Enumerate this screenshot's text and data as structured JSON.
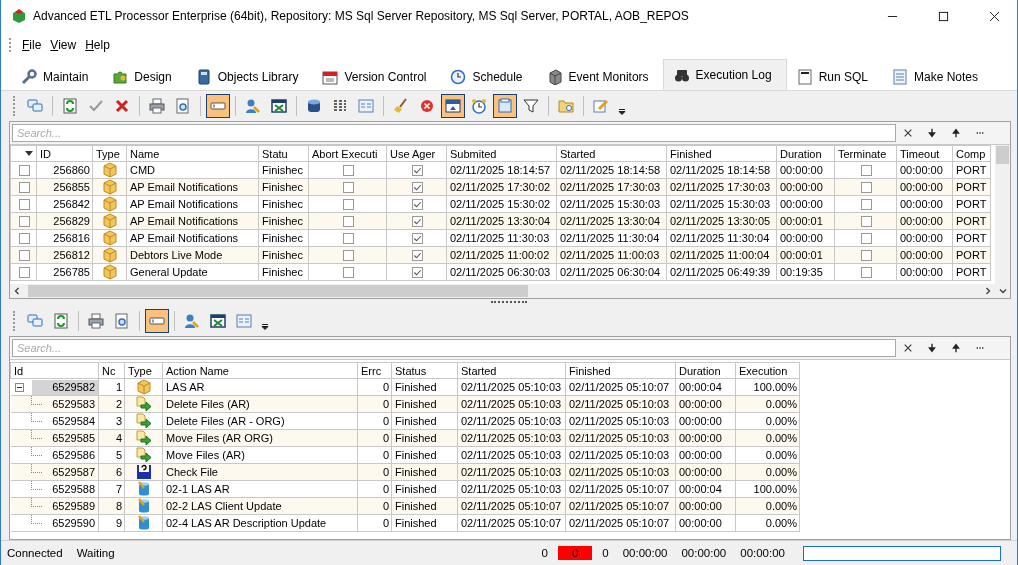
{
  "window": {
    "title": "Advanced ETL Processor Enterprise (64bit), Repository: MS Sql Server Repository, MS Sql Server, PORTAL, AOB_REPOS"
  },
  "menu": [
    "File",
    "View",
    "Help"
  ],
  "tabs": [
    {
      "label": "Maintain",
      "selected": false
    },
    {
      "label": "Design",
      "selected": false
    },
    {
      "label": "Objects Library",
      "selected": false
    },
    {
      "label": "Version Control",
      "selected": false
    },
    {
      "label": "Schedule",
      "selected": false
    },
    {
      "label": "Event Monitors",
      "selected": false
    },
    {
      "label": "Execution Log",
      "selected": true
    },
    {
      "label": "Run SQL",
      "selected": false
    },
    {
      "label": "Make Notes",
      "selected": false
    }
  ],
  "toolbar": [
    {
      "kind": "comment",
      "on": false
    },
    {
      "kind": "separator"
    },
    {
      "kind": "refresh",
      "on": false
    },
    {
      "kind": "check",
      "on": false
    },
    {
      "kind": "delete",
      "on": false
    },
    {
      "kind": "separator"
    },
    {
      "kind": "print",
      "on": false
    },
    {
      "kind": "preview",
      "on": false
    },
    {
      "kind": "separator"
    },
    {
      "kind": "field",
      "on": true
    },
    {
      "kind": "separator"
    },
    {
      "kind": "userdb",
      "on": false
    },
    {
      "kind": "excel",
      "on": false
    },
    {
      "kind": "separator"
    },
    {
      "kind": "database",
      "on": false
    },
    {
      "kind": "columns",
      "on": false
    },
    {
      "kind": "form",
      "on": false
    },
    {
      "kind": "separator"
    },
    {
      "kind": "broom",
      "on": false
    },
    {
      "kind": "stop",
      "on": false
    },
    {
      "kind": "panel",
      "on": true
    },
    {
      "kind": "clock",
      "on": false
    },
    {
      "kind": "panel2",
      "on": true
    },
    {
      "kind": "filter",
      "on": false
    },
    {
      "kind": "separator"
    },
    {
      "kind": "folder",
      "on": false
    },
    {
      "kind": "separator"
    },
    {
      "kind": "edit",
      "on": false
    },
    {
      "kind": "dropdown",
      "on": false
    }
  ],
  "log_search": {
    "placeholder": "Search..."
  },
  "log_table": {
    "columns": [
      "ID",
      "Type",
      "Name",
      "Statu",
      "Abort Executi",
      "Use Ager",
      "Submited",
      "Started",
      "Finished",
      "Duration",
      "Terminate",
      "Timeout",
      "Comp"
    ],
    "rows": [
      {
        "selected": false,
        "id": "256860",
        "kind": "package",
        "name": "CMD",
        "status": "Finishec",
        "abort_execution": false,
        "use_agent": true,
        "submitted": "02/11/2025 18:14:57",
        "started": "02/11/2025 18:14:58",
        "finished": "02/11/2025 18:14:58",
        "duration": "00:00:00",
        "terminate": false,
        "timeout": "00:00:00",
        "company": "PORT"
      },
      {
        "selected": false,
        "id": "256855",
        "kind": "package",
        "name": "AP Email Notifications",
        "status": "Finishec",
        "abort_execution": false,
        "use_agent": true,
        "submitted": "02/11/2025 17:30:02",
        "started": "02/11/2025 17:30:03",
        "finished": "02/11/2025 17:30:03",
        "duration": "00:00:00",
        "terminate": false,
        "timeout": "00:00:00",
        "company": "PORT"
      },
      {
        "selected": false,
        "id": "256842",
        "kind": "package",
        "name": "AP Email Notifications",
        "status": "Finishec",
        "abort_execution": false,
        "use_agent": true,
        "submitted": "02/11/2025 15:30:02",
        "started": "02/11/2025 15:30:03",
        "finished": "02/11/2025 15:30:03",
        "duration": "00:00:00",
        "terminate": false,
        "timeout": "00:00:00",
        "company": "PORT"
      },
      {
        "selected": false,
        "id": "256829",
        "kind": "package",
        "name": "AP Email Notifications",
        "status": "Finishec",
        "abort_execution": false,
        "use_agent": true,
        "submitted": "02/11/2025 13:30:04",
        "started": "02/11/2025 13:30:04",
        "finished": "02/11/2025 13:30:05",
        "duration": "00:00:01",
        "terminate": false,
        "timeout": "00:00:00",
        "company": "PORT"
      },
      {
        "selected": false,
        "id": "256816",
        "kind": "package",
        "name": "AP Email Notifications",
        "status": "Finishec",
        "abort_execution": false,
        "use_agent": true,
        "submitted": "02/11/2025 11:30:03",
        "started": "02/11/2025 11:30:04",
        "finished": "02/11/2025 11:30:04",
        "duration": "00:00:00",
        "terminate": false,
        "timeout": "00:00:00",
        "company": "PORT"
      },
      {
        "selected": false,
        "id": "256812",
        "kind": "package",
        "name": "Debtors Live Mode",
        "status": "Finishec",
        "abort_execution": false,
        "use_agent": true,
        "submitted": "02/11/2025 11:00:02",
        "started": "02/11/2025 11:00:03",
        "finished": "02/11/2025 11:00:04",
        "duration": "00:00:01",
        "terminate": false,
        "timeout": "00:00:00",
        "company": "PORT"
      },
      {
        "selected": false,
        "id": "256785",
        "kind": "package",
        "name": "General Update",
        "status": "Finishec",
        "abort_execution": false,
        "use_agent": true,
        "submitted": "02/11/2025 06:30:03",
        "started": "02/11/2025 06:30:04",
        "finished": "02/11/2025 06:49:39",
        "duration": "00:19:35",
        "terminate": false,
        "timeout": "00:00:00",
        "company": "PORT"
      }
    ]
  },
  "detail_toolbar": [
    {
      "kind": "comment",
      "on": false
    },
    {
      "kind": "refresh",
      "on": false
    },
    {
      "kind": "separator"
    },
    {
      "kind": "print",
      "on": false
    },
    {
      "kind": "preview",
      "on": false
    },
    {
      "kind": "separator"
    },
    {
      "kind": "field",
      "on": true
    },
    {
      "kind": "separator"
    },
    {
      "kind": "userdb",
      "on": false
    },
    {
      "kind": "excel",
      "on": false
    },
    {
      "kind": "form",
      "on": false
    },
    {
      "kind": "dropdown",
      "on": false
    }
  ],
  "detail_search": {
    "placeholder": "Search..."
  },
  "detail_table": {
    "columns": [
      "Id",
      "Nc",
      "Type",
      "Action Name",
      "Errc",
      "Status",
      "Started",
      "Finished",
      "Duration",
      "Execution"
    ],
    "rows": [
      {
        "id": "6529582",
        "no": "1",
        "kind": "package",
        "action_name": "LAS AR",
        "errors": "0",
        "status": "Finished",
        "started": "02/11/2025 05:10:03",
        "finished": "02/11/2025 05:10:07",
        "duration": "00:00:04",
        "execution": "100.00%",
        "selected": true,
        "expanded": true,
        "children": [
          {
            "id": "6529583",
            "no": "2",
            "kind": "filemove",
            "action_name": "Delete Files (AR)",
            "errors": "0",
            "status": "Finished",
            "started": "02/11/2025 05:10:03",
            "finished": "02/11/2025 05:10:03",
            "duration": "00:00:00",
            "execution": "0.00%",
            "selected": false
          },
          {
            "id": "6529584",
            "no": "3",
            "kind": "filemove",
            "action_name": "Delete Files (AR - ORG)",
            "errors": "0",
            "status": "Finished",
            "started": "02/11/2025 05:10:03",
            "finished": "02/11/2025 05:10:03",
            "duration": "00:00:00",
            "execution": "0.00%",
            "selected": false
          },
          {
            "id": "6529585",
            "no": "4",
            "kind": "filemove",
            "action_name": "Move Files (AR ORG)",
            "errors": "0",
            "status": "Finished",
            "started": "02/11/2025 05:10:03",
            "finished": "02/11/2025 05:10:03",
            "duration": "00:00:00",
            "execution": "0.00%",
            "selected": false
          },
          {
            "id": "6529586",
            "no": "5",
            "kind": "filemove",
            "action_name": "Move Files (AR)",
            "errors": "0",
            "status": "Finished",
            "started": "02/11/2025 05:10:03",
            "finished": "02/11/2025 05:10:03",
            "duration": "00:00:00",
            "execution": "0.00%",
            "selected": false
          },
          {
            "id": "6529587",
            "no": "6",
            "kind": "checkfile",
            "action_name": "Check File",
            "errors": "0",
            "status": "Finished",
            "started": "02/11/2025 05:10:03",
            "finished": "02/11/2025 05:10:03",
            "duration": "00:00:00",
            "execution": "0.00%",
            "selected": false
          },
          {
            "id": "6529588",
            "no": "7",
            "kind": "sql",
            "action_name": "02-1 LAS AR",
            "errors": "0",
            "status": "Finished",
            "started": "02/11/2025 05:10:03",
            "finished": "02/11/2025 05:10:07",
            "duration": "00:00:04",
            "execution": "100.00%",
            "selected": false
          },
          {
            "id": "6529589",
            "no": "8",
            "kind": "sql",
            "action_name": "02-2 LAS Client Update",
            "errors": "0",
            "status": "Finished",
            "started": "02/11/2025 05:10:07",
            "finished": "02/11/2025 05:10:07",
            "duration": "00:00:00",
            "execution": "0.00%",
            "selected": false
          },
          {
            "id": "6529590",
            "no": "9",
            "kind": "sql",
            "action_name": "02-4 LAS AR Description Update",
            "errors": "0",
            "status": "Finished",
            "started": "02/11/2025 05:10:07",
            "finished": "02/11/2025 05:10:07",
            "duration": "00:00:00",
            "execution": "0.00%",
            "selected": false
          }
        ]
      }
    ]
  },
  "status_bar": {
    "connection": "Connected",
    "state": "Waiting",
    "count_1": "0",
    "errors": "0",
    "count_2": "0",
    "time_1": "00:00:00",
    "time_2": "00:00:00",
    "time_3": "00:00:00"
  }
}
